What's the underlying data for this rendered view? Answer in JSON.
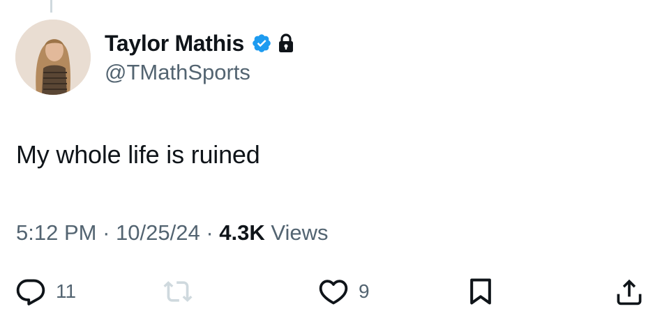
{
  "author": {
    "display_name": "Taylor Mathis",
    "handle": "@TMathSports",
    "verified": true,
    "protected": true,
    "verified_color": "#1d9bf0"
  },
  "tweet": {
    "text": "My whole life is ruined",
    "time": "5:12 PM",
    "date": "10/25/24",
    "views_count": "4.3K",
    "views_label": "Views"
  },
  "actions": {
    "reply_count": "11",
    "like_count": "9"
  },
  "icons": [
    "reply-icon",
    "retweet-icon",
    "like-icon",
    "bookmark-icon",
    "share-icon",
    "verified-badge-icon",
    "lock-icon"
  ]
}
